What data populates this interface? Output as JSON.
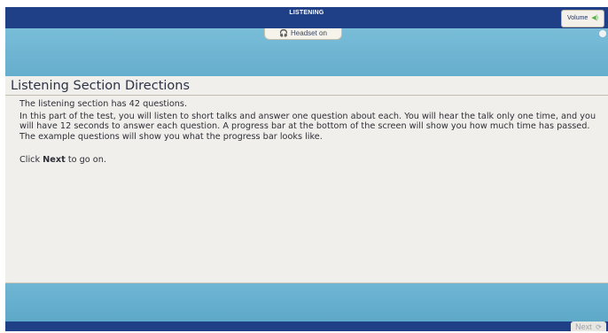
{
  "header": {
    "section_title": "LISTENING",
    "volume_label": "Volume",
    "volume_icon": "speaker-icon"
  },
  "headset": {
    "label": "Headset on",
    "icon": "headphones-icon"
  },
  "page": {
    "title": "Listening Section Directions",
    "paragraphs": [
      "The listening section has 42 questions.",
      "In this part of the test, you will listen to short talks and answer one question about each. You will hear the talk only one time, and you will have 12 seconds to answer each question. A progress bar at the bottom of the screen will show you how much time has passed. The example questions will show you what the progress bar looks like."
    ],
    "instruction_prefix": "Click ",
    "instruction_bold": "Next",
    "instruction_suffix": " to go on."
  },
  "footer": {
    "next_label": "Next",
    "next_icon": "arrow-circle-icon"
  },
  "colors": {
    "header_blue": "#1f3f86",
    "band_teal": "#6fb6d4",
    "content_bg": "#f1efec",
    "volume_icon": "#55b24a"
  }
}
